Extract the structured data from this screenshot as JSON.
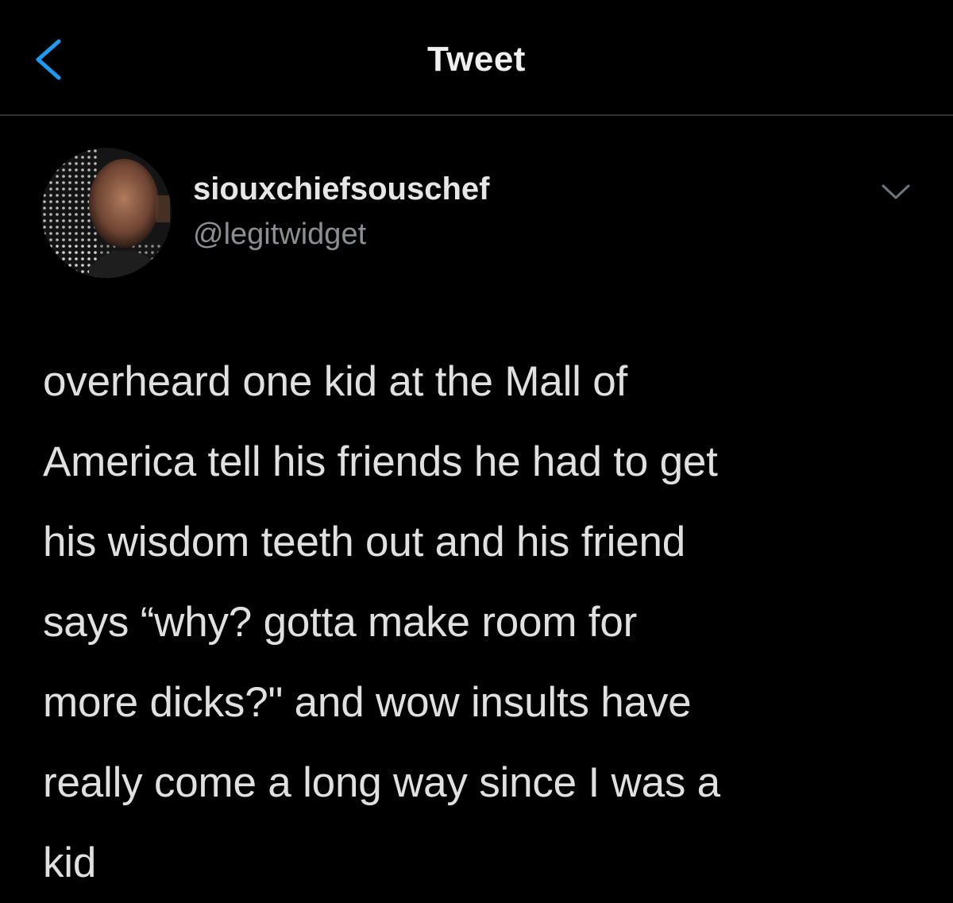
{
  "header": {
    "title": "Tweet",
    "back_icon": "chevron-left-icon"
  },
  "author": {
    "display_name": "siouxchiefsouschef",
    "handle": "@legitwidget",
    "menu_icon": "chevron-down-icon"
  },
  "tweet": {
    "text": "overheard one kid at the Mall of\nAmerica tell his friends he had to get\nhis wisdom teeth out and his friend\nsays “why? gotta make room for\nmore dicks?\" and wow insults have\nreally come a long way since I was a\nkid"
  },
  "colors": {
    "background": "#000000",
    "accent": "#1d9bf0",
    "primary_text": "#e0e0e0",
    "secondary_text": "#8b8f94",
    "divider": "#2f3336"
  }
}
